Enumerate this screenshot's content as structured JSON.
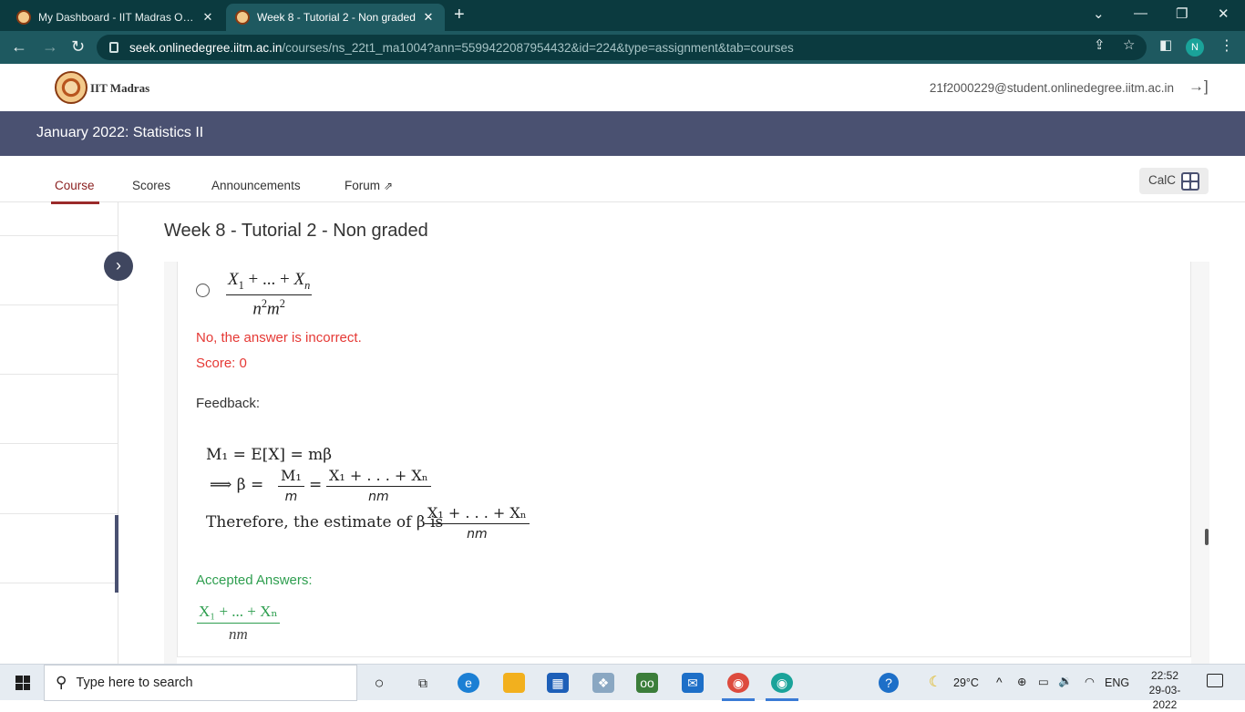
{
  "browser": {
    "tabs": [
      {
        "title": "My Dashboard - IIT Madras Onlin",
        "close": "✕"
      },
      {
        "title": "Week 8 - Tutorial 2 - Non graded",
        "close": "✕"
      }
    ],
    "new_tab": "+",
    "url_host": "seek.onlinedegree.iitm.ac.in",
    "url_path": "/courses/ns_22t1_ma1004?ann=5599422087954432&id=224&type=assignment&tab=courses",
    "profile_initial": "N"
  },
  "header": {
    "logo_text": "IIT Madras",
    "user_email": "21f2000229@student.onlinedegree.iitm.ac.in"
  },
  "course": {
    "title": "January 2022: Statistics II",
    "tabs": [
      "Course",
      "Scores",
      "Announcements",
      "Forum"
    ],
    "calc_label": "CalC"
  },
  "assignment": {
    "title": "Week 8 - Tutorial 2 - Non graded",
    "option": {
      "num_x1": "X",
      "num_sub1": "1",
      "num_mid": " + ... + ",
      "num_xn": "X",
      "num_subn": "n",
      "den_n": "n",
      "den_m": "m",
      "den_exp": "2"
    },
    "result_text": "No, the answer is incorrect.",
    "score_text": "Score: 0",
    "feedback_label": "Feedback:",
    "feedback": {
      "line1": "M₁ = E[X] = mβ",
      "line2_prefix": "⟹ β =",
      "frac1_num": "M₁",
      "frac1_den": "m",
      "eq": "=",
      "frac2_num": "X₁ + . . . + Xₙ",
      "frac2_den": "nm",
      "line3_prefix": "Therefore, the estimate of β is",
      "frac3_num": "X₁ + . . . + Xₙ",
      "frac3_den": "nm"
    },
    "accepted_label": "Accepted Answers:",
    "accepted": {
      "num": "X₁ + ... + Xₙ",
      "den": "nm"
    }
  },
  "taskbar": {
    "search_placeholder": "Type here to search",
    "weather": "29°C",
    "language": "ENG",
    "time": "22:52",
    "date": "29-03-2022"
  }
}
